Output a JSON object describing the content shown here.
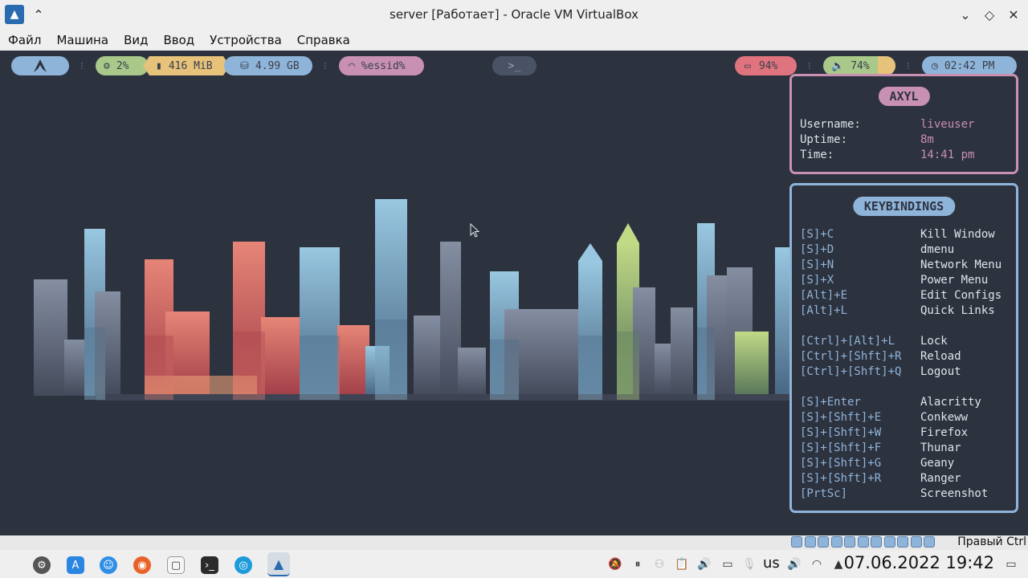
{
  "window": {
    "title": "server [Работает] - Oracle VM VirtualBox",
    "menu": [
      "Файл",
      "Машина",
      "Вид",
      "Ввод",
      "Устройства",
      "Справка"
    ]
  },
  "topbar": {
    "cpu": "2%",
    "memory": "416 MiB",
    "disk": "4.99 GB",
    "wifi": "%essid%",
    "terminal": ">_",
    "battery": "94%",
    "volume": "74%",
    "clock": "02:42 PM"
  },
  "axyl": {
    "title": "AXYL",
    "rows": [
      {
        "key": "Username:",
        "value": "liveuser"
      },
      {
        "key": "Uptime:",
        "value": "8m"
      },
      {
        "key": "Time:",
        "value": "14:41 pm"
      }
    ]
  },
  "keybindings": {
    "title": "KEYBINDINGS",
    "rows": [
      {
        "key": "[S]+C",
        "value": "Kill Window"
      },
      {
        "key": "[S]+D",
        "value": "dmenu"
      },
      {
        "key": "[S]+N",
        "value": "Network Menu"
      },
      {
        "key": "[S]+X",
        "value": "Power Menu"
      },
      {
        "key": "[Alt]+E",
        "value": "Edit Configs"
      },
      {
        "key": "[Alt]+L",
        "value": "Quick Links"
      },
      {
        "key": "[Ctrl]+[Alt]+L",
        "value": "Lock"
      },
      {
        "key": "[Ctrl]+[Shft]+R",
        "value": "Reload"
      },
      {
        "key": "[Ctrl]+[Shft]+Q",
        "value": "Logout"
      },
      {
        "key": "[S]+Enter",
        "value": "Alacritty"
      },
      {
        "key": "[S]+[Shft]+E",
        "value": "Conkeww"
      },
      {
        "key": "[S]+[Shft]+W",
        "value": "Firefox"
      },
      {
        "key": "[S]+[Shft]+F",
        "value": "Thunar"
      },
      {
        "key": "[S]+[Shft]+G",
        "value": "Geany"
      },
      {
        "key": "[S]+[Shft]+R",
        "value": "Ranger"
      },
      {
        "key": "[PrtSc]",
        "value": "Screenshot"
      }
    ]
  },
  "vbox_status": {
    "host_key": "Правый Ctrl"
  },
  "taskbar": {
    "keyboard_layout": "us",
    "datetime": "07.06.2022 19:42"
  },
  "colors": {
    "vm_background": "#2d323f",
    "accent_blue": "#8fb4d9",
    "accent_pink": "#c891b1",
    "accent_green": "#a9c98a",
    "accent_yellow": "#e6c27a",
    "accent_red": "#e0747e",
    "text_light": "#dfe3ea"
  }
}
